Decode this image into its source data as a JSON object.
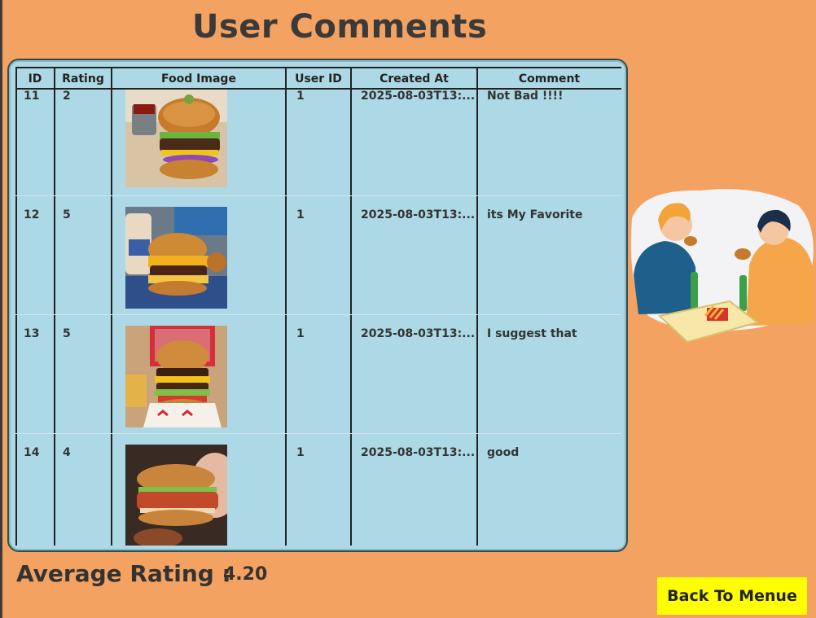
{
  "page": {
    "title": "User Comments"
  },
  "table": {
    "headers": [
      "ID",
      "Rating",
      "Food Image",
      "User ID",
      "Created At",
      "Comment"
    ],
    "rows": [
      {
        "id": "11",
        "rating": "2",
        "image": "burger-photo",
        "user_id": "1",
        "created_at": "2025-08-03T13:...",
        "comment": "Not Bad !!!!"
      },
      {
        "id": "12",
        "rating": "5",
        "image": "burger-photo",
        "user_id": "1",
        "created_at": "2025-08-03T13:...",
        "comment": "its My Favorite"
      },
      {
        "id": "13",
        "rating": "5",
        "image": "burger-photo",
        "user_id": "1",
        "created_at": "2025-08-03T13:...",
        "comment": "I suggest that"
      },
      {
        "id": "14",
        "rating": "4",
        "image": "burger-photo",
        "user_id": "1",
        "created_at": "2025-08-03T13:...",
        "comment": "good"
      }
    ]
  },
  "summary": {
    "label": "Average Rating :",
    "value": "4.20"
  },
  "actions": {
    "back_label": "Back To Menue"
  },
  "icons": {
    "illustration": "people-eating-burgers-illustration"
  },
  "colors": {
    "background": "#F4A261",
    "table_bg": "#ADD8E6",
    "button_bg": "#FFFF00"
  }
}
